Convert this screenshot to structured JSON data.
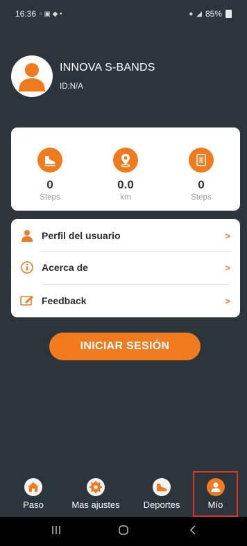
{
  "status_bar": {
    "time": "16:36",
    "battery": "85%"
  },
  "profile": {
    "name": "INNOVA S-BANDS",
    "id": "ID:N/A"
  },
  "stats": [
    {
      "icon": "shoe-icon",
      "value": "0",
      "label": "Steps"
    },
    {
      "icon": "location-pin-icon",
      "value": "0.0",
      "label": "km"
    },
    {
      "icon": "list-icon",
      "value": "0",
      "label": "Steps"
    }
  ],
  "menu": [
    {
      "label": "Perfil del usuario",
      "arrow": ">",
      "icon": "user-icon"
    },
    {
      "label": "Acerca de",
      "arrow": ">",
      "icon": "info-icon"
    },
    {
      "label": "Feedback",
      "arrow": ">",
      "icon": "feedback-icon"
    }
  ],
  "login_label": "INICIAR SESIÓN",
  "nav": [
    {
      "label": "Paso",
      "icon": "home-icon",
      "active": false
    },
    {
      "label": "Mas ajustes",
      "icon": "settings-icon",
      "active": false
    },
    {
      "label": "Deportes",
      "icon": "sport-shoe-icon",
      "active": false
    },
    {
      "label": "Mío",
      "icon": "profile-icon",
      "active": true
    }
  ],
  "colors": {
    "accent": "#f07b1e",
    "background": "#2c343c",
    "highlight": "#d9362b"
  }
}
